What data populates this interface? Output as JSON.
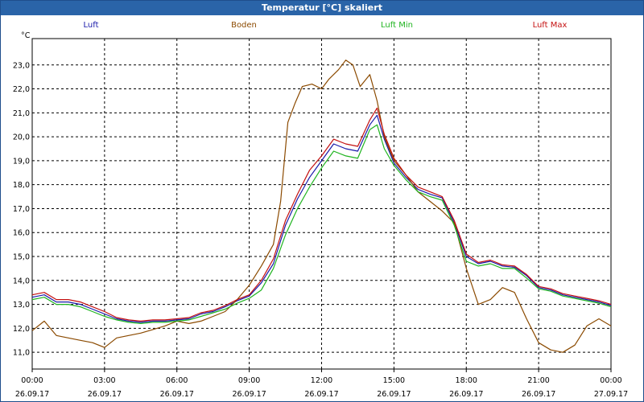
{
  "window": {
    "title": "Temperatur [°C] skaliert"
  },
  "chart_data": {
    "type": "line",
    "ylabel": "°C",
    "ylim": [
      10.3,
      24.1
    ],
    "y_ticks": [
      11.0,
      12.0,
      13.0,
      14.0,
      15.0,
      16.0,
      17.0,
      18.0,
      19.0,
      20.0,
      21.0,
      22.0,
      23.0
    ],
    "y_tick_labels": [
      "11,0",
      "12,0",
      "13,0",
      "14,0",
      "15,0",
      "16,0",
      "17,0",
      "18,0",
      "19,0",
      "20,0",
      "21,0",
      "22,0",
      "23,0"
    ],
    "xlim_hours": [
      0,
      24
    ],
    "x_ticks": [
      {
        "h": 0,
        "time": "00:00",
        "date": "26.09.17"
      },
      {
        "h": 3,
        "time": "03:00",
        "date": "26.09.17"
      },
      {
        "h": 6,
        "time": "06:00",
        "date": "26.09.17"
      },
      {
        "h": 9,
        "time": "09:00",
        "date": "26.09.17"
      },
      {
        "h": 12,
        "time": "12:00",
        "date": "26.09.17"
      },
      {
        "h": 15,
        "time": "15:00",
        "date": "26.09.17"
      },
      {
        "h": 18,
        "time": "18:00",
        "date": "26.09.17"
      },
      {
        "h": 21,
        "time": "21:00",
        "date": "26.09.17"
      },
      {
        "h": 24,
        "time": "00:00",
        "date": "27.09.17"
      }
    ],
    "grid": true,
    "legend_position": "top",
    "series": [
      {
        "name": "Luft",
        "color": "#1a1aaa",
        "x": [
          0,
          0.5,
          1,
          1.5,
          2,
          2.5,
          3,
          3.5,
          4,
          4.5,
          5,
          5.5,
          6,
          6.5,
          7,
          7.5,
          8,
          8.5,
          9,
          9.5,
          10,
          10.5,
          11,
          11.5,
          12,
          12.5,
          13,
          13.5,
          14,
          14.3,
          14.6,
          15,
          15.5,
          16,
          16.5,
          17,
          17.5,
          18,
          18.5,
          19,
          19.5,
          20,
          20.5,
          21,
          21.5,
          22,
          22.5,
          23,
          23.5,
          24
        ],
        "y": [
          13.3,
          13.4,
          13.1,
          13.1,
          13.0,
          12.8,
          12.6,
          12.4,
          12.3,
          12.25,
          12.3,
          12.3,
          12.35,
          12.4,
          12.6,
          12.7,
          12.9,
          13.15,
          13.35,
          13.9,
          14.7,
          16.3,
          17.4,
          18.3,
          19.0,
          19.7,
          19.5,
          19.4,
          20.5,
          20.9,
          19.9,
          18.9,
          18.3,
          17.8,
          17.6,
          17.45,
          16.4,
          15.0,
          14.7,
          14.8,
          14.6,
          14.55,
          14.2,
          13.7,
          13.6,
          13.4,
          13.3,
          13.2,
          13.1,
          12.95
        ]
      },
      {
        "name": "Boden",
        "color": "#8b4a00",
        "x": [
          0,
          0.5,
          1,
          1.5,
          2,
          2.5,
          3,
          3.5,
          4,
          4.5,
          5,
          5.5,
          6,
          6.5,
          7,
          7.5,
          8,
          8.5,
          9,
          9.5,
          10,
          10.3,
          10.6,
          10.9,
          11.2,
          11.6,
          12,
          12.3,
          12.7,
          13,
          13.3,
          13.6,
          14,
          14.3,
          14.6,
          15,
          15.5,
          16,
          16.5,
          17,
          17.5,
          18,
          18.5,
          19,
          19.5,
          20,
          20.5,
          21,
          21.5,
          22,
          22.5,
          23,
          23.5,
          24
        ],
        "y": [
          11.9,
          12.3,
          11.7,
          11.6,
          11.5,
          11.4,
          11.2,
          11.6,
          11.7,
          11.8,
          11.95,
          12.1,
          12.3,
          12.2,
          12.3,
          12.5,
          12.7,
          13.2,
          13.8,
          14.6,
          15.5,
          17.3,
          20.6,
          21.4,
          22.1,
          22.2,
          22.0,
          22.4,
          22.8,
          23.2,
          23.0,
          22.1,
          22.6,
          21.5,
          20.0,
          19.0,
          18.4,
          17.7,
          17.3,
          16.9,
          16.4,
          14.5,
          13.0,
          13.2,
          13.7,
          13.5,
          12.4,
          11.4,
          11.1,
          11.0,
          11.3,
          12.1,
          12.4,
          12.1
        ]
      },
      {
        "name": "Luft Min",
        "color": "#1fb41f",
        "x": [
          0,
          0.5,
          1,
          1.5,
          2,
          2.5,
          3,
          3.5,
          4,
          4.5,
          5,
          5.5,
          6,
          6.5,
          7,
          7.5,
          8,
          8.5,
          9,
          9.5,
          10,
          10.5,
          11,
          11.5,
          12,
          12.5,
          13,
          13.5,
          14,
          14.3,
          14.6,
          15,
          15.5,
          16,
          16.5,
          17,
          17.5,
          18,
          18.5,
          19,
          19.5,
          20,
          20.5,
          21,
          21.5,
          22,
          22.5,
          23,
          23.5,
          24
        ],
        "y": [
          13.2,
          13.3,
          13.0,
          13.0,
          12.9,
          12.7,
          12.5,
          12.35,
          12.25,
          12.2,
          12.25,
          12.25,
          12.3,
          12.35,
          12.5,
          12.65,
          12.8,
          13.05,
          13.25,
          13.6,
          14.5,
          15.9,
          17.0,
          17.9,
          18.7,
          19.4,
          19.2,
          19.1,
          20.3,
          20.5,
          19.5,
          18.8,
          18.2,
          17.7,
          17.5,
          17.35,
          16.3,
          14.8,
          14.6,
          14.7,
          14.5,
          14.5,
          14.1,
          13.65,
          13.55,
          13.35,
          13.25,
          13.15,
          13.05,
          12.9
        ]
      },
      {
        "name": "Luft Max",
        "color": "#c41010",
        "x": [
          0,
          0.5,
          1,
          1.5,
          2,
          2.5,
          3,
          3.5,
          4,
          4.5,
          5,
          5.5,
          6,
          6.5,
          7,
          7.5,
          8,
          8.5,
          9,
          9.5,
          10,
          10.5,
          11,
          11.5,
          12,
          12.5,
          13,
          13.5,
          14,
          14.3,
          14.6,
          15,
          15.5,
          16,
          16.5,
          17,
          17.5,
          18,
          18.5,
          19,
          19.5,
          20,
          20.5,
          21,
          21.5,
          22,
          22.5,
          23,
          23.5,
          24
        ],
        "y": [
          13.4,
          13.5,
          13.2,
          13.2,
          13.1,
          12.9,
          12.7,
          12.45,
          12.35,
          12.3,
          12.35,
          12.35,
          12.4,
          12.45,
          12.65,
          12.75,
          12.95,
          13.2,
          13.4,
          14.0,
          14.9,
          16.5,
          17.6,
          18.6,
          19.2,
          19.9,
          19.7,
          19.6,
          20.7,
          21.2,
          20.1,
          19.1,
          18.4,
          17.9,
          17.7,
          17.5,
          16.5,
          15.1,
          14.75,
          14.85,
          14.65,
          14.6,
          14.25,
          13.75,
          13.65,
          13.45,
          13.35,
          13.25,
          13.15,
          13.0
        ]
      }
    ]
  }
}
